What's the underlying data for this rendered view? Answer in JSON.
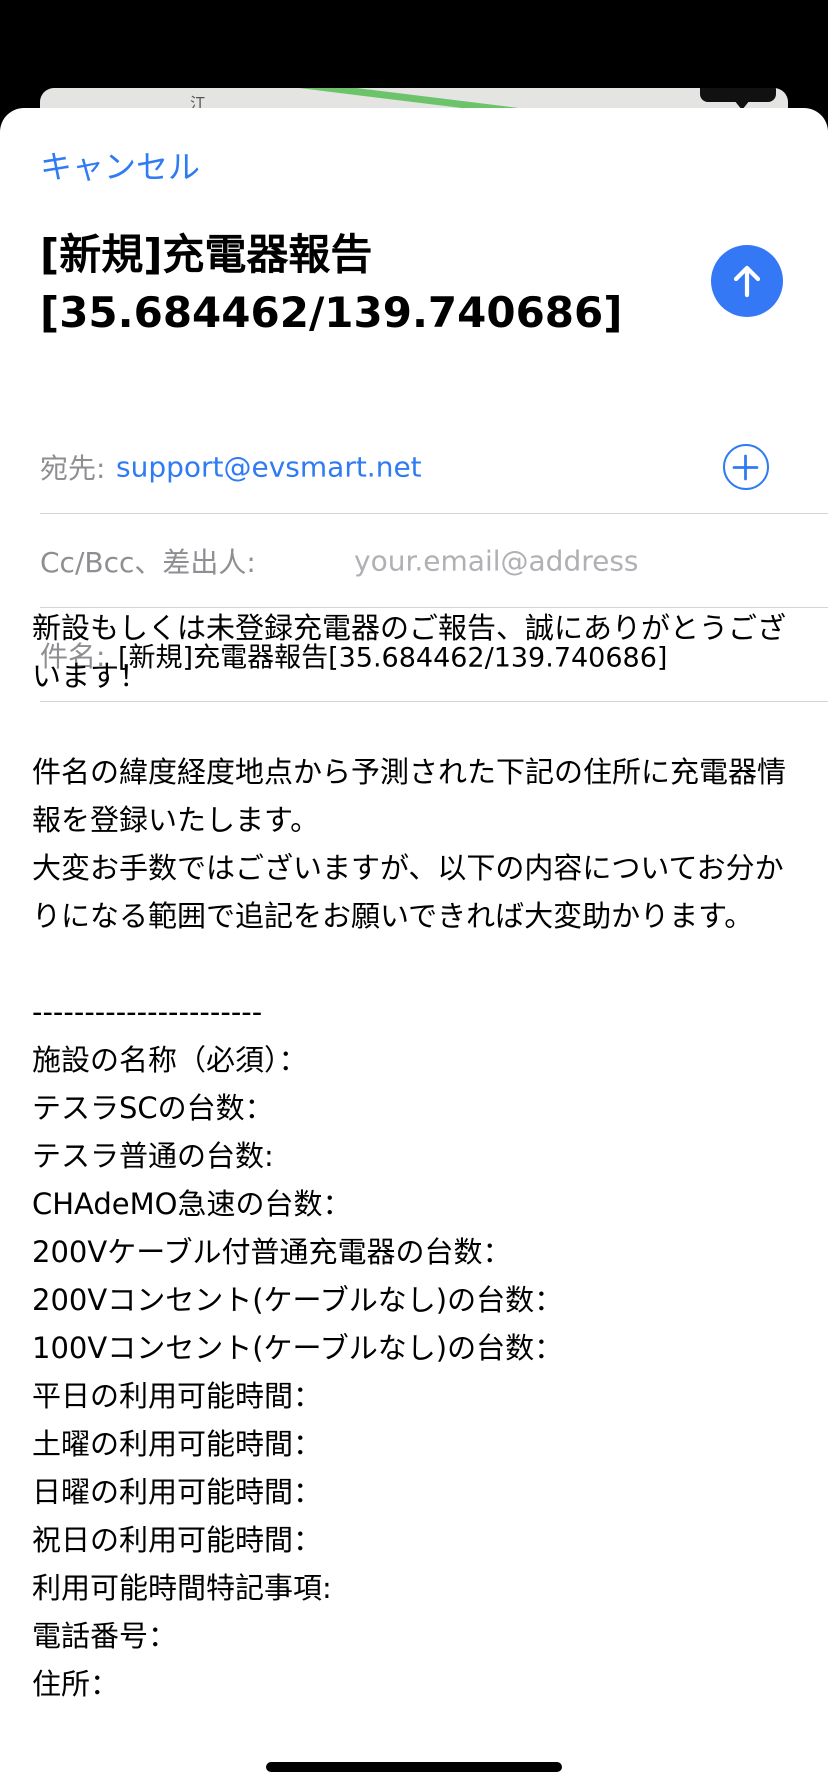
{
  "map": {
    "label": "江"
  },
  "header": {
    "cancel_label": "キャンセル",
    "title": "[新規]充電器報告\n[35.684462/139.740686]"
  },
  "fields": {
    "to_label": "宛先:",
    "to_value": "support@evsmart.net",
    "cc_label": "Cc/Bcc、差出人:",
    "cc_value": "your.email@address",
    "subject_label": "件名:",
    "subject_value": "[新規]充電器報告[35.684462/139.740686]"
  },
  "body": {
    "text": "新設もしくは未登録充電器のご報告、誠にありがとうございます！\n\n件名の緯度経度地点から予測された下記の住所に充電器情報を登録いたします。\n大変お手数ではございますが、以下の内容についてお分かりになる範囲で追記をお願いできれば大変助かります。\n\n----------------------\n施設の名称（必須）：\nテスラSCの台数：\nテスラ普通の台数:\nCHAdeMO急速の台数：\n200Vケーブル付普通充電器の台数：\n200Vコンセント(ケーブルなし)の台数：\n100Vコンセント(ケーブルなし)の台数：\n平日の利用可能時間：\n土曜の利用可能時間：\n日曜の利用可能時間：\n祝日の利用可能時間：\n利用可能時間特記事項:\n電話番号：\n住所："
  },
  "colors": {
    "accent": "#2f7bf3",
    "send_button": "#3478f6",
    "placeholder": "#b0b0b5",
    "label": "#8e8e93",
    "map_road": "#6cc46a"
  },
  "icons": {
    "send": "arrow-up-icon",
    "add": "plus-circle-icon"
  }
}
